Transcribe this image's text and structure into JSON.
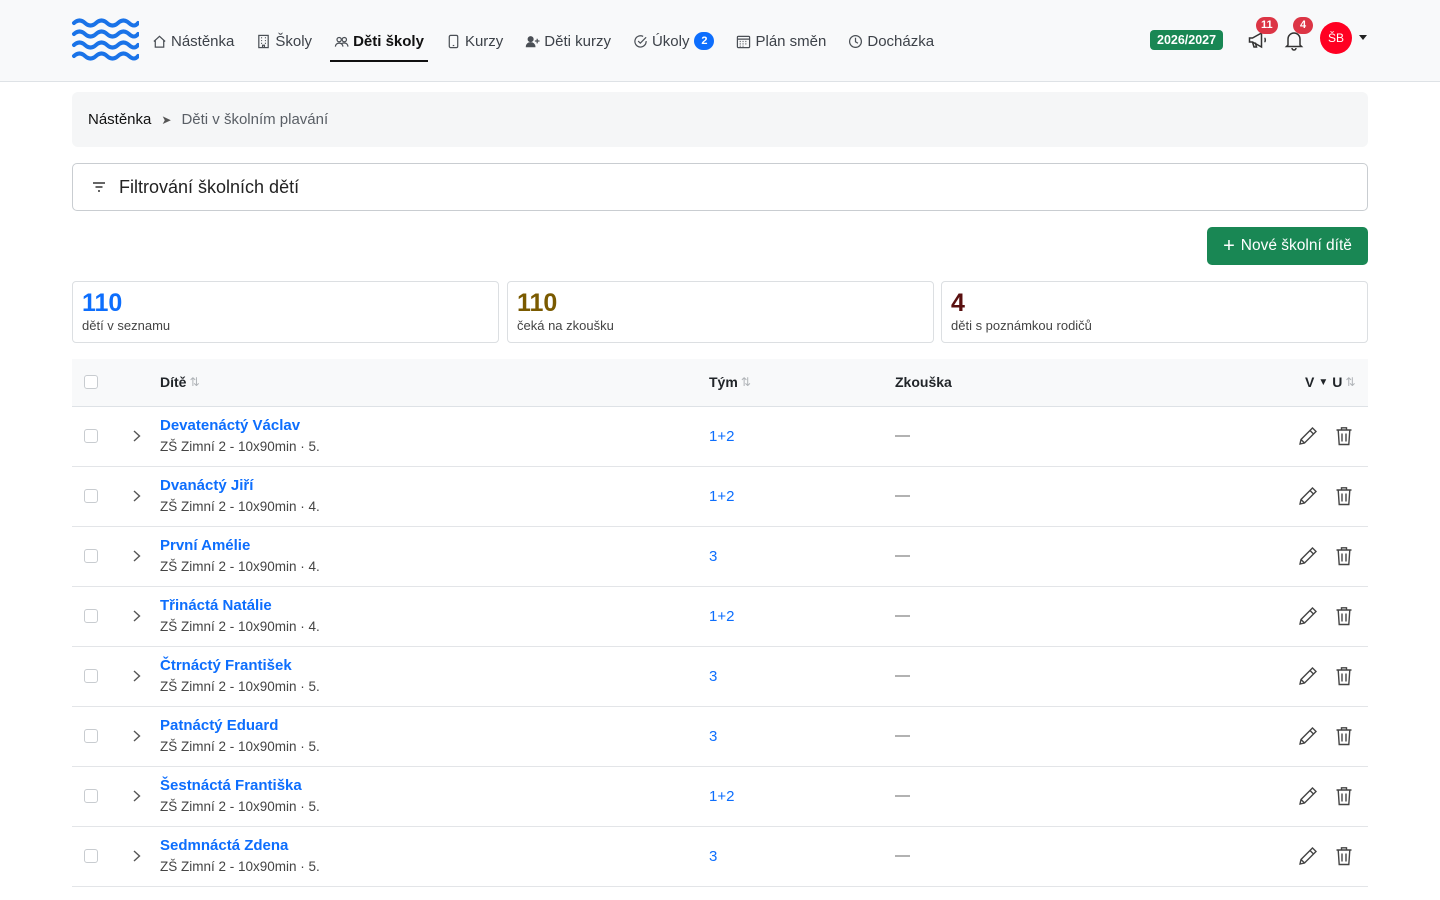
{
  "nav": {
    "items": [
      {
        "label": "Nástěnka",
        "icon": "house-icon"
      },
      {
        "label": "Školy",
        "icon": "building-icon"
      },
      {
        "label": "Děti školy",
        "icon": "people-icon",
        "active": true
      },
      {
        "label": "Kurzy",
        "icon": "tablet-icon"
      },
      {
        "label": "Děti kurzy",
        "icon": "person-plus-icon"
      },
      {
        "label": "Úkoly",
        "icon": "check-circle-icon",
        "badge": "2"
      },
      {
        "label": "Plán směn",
        "icon": "calendar-icon"
      },
      {
        "label": "Docházka",
        "icon": "clock-icon"
      }
    ],
    "year": "2026/2027",
    "announcements_count": "11",
    "notifications_count": "4",
    "avatar_initials": "ŠB"
  },
  "breadcrumb": {
    "home": "Nástěnka",
    "separator": "➤",
    "current": "Děti v školním plavání"
  },
  "filter": {
    "label": "Filtrování školních dětí"
  },
  "new_button": {
    "label": "Nové školní dítě"
  },
  "stats": [
    {
      "value": "110",
      "label": "dětí v seznamu",
      "color": "#0d6efd"
    },
    {
      "value": "110",
      "label": "čeká na zkoušku",
      "color": "#7a5a00"
    },
    {
      "value": "4",
      "label": "děti s poznámkou rodičů",
      "color": "#5a1010"
    }
  ],
  "table": {
    "headers": {
      "child": "Dítě",
      "team": "Tým",
      "exam": "Zkouška",
      "vu_left": "V",
      "vu_right": "U"
    },
    "rows": [
      {
        "name": "Devatenáctý Václav",
        "sub": "ZŠ Zimní 2 - 10x90min · 5.",
        "team": "1+2",
        "exam": "—"
      },
      {
        "name": "Dvanáctý Jiří",
        "sub": "ZŠ Zimní 2 - 10x90min · 4.",
        "team": "1+2",
        "exam": "—"
      },
      {
        "name": "První Amélie",
        "sub": "ZŠ Zimní 2 - 10x90min · 4.",
        "team": "3",
        "exam": "—"
      },
      {
        "name": "Třináctá Natálie",
        "sub": "ZŠ Zimní 2 - 10x90min · 4.",
        "team": "1+2",
        "exam": "—"
      },
      {
        "name": "Čtrnáctý František",
        "sub": "ZŠ Zimní 2 - 10x90min · 5.",
        "team": "3",
        "exam": "—"
      },
      {
        "name": "Patnáctý Eduard",
        "sub": "ZŠ Zimní 2 - 10x90min · 5.",
        "team": "3",
        "exam": "—"
      },
      {
        "name": "Šestnáctá Františka",
        "sub": "ZŠ Zimní 2 - 10x90min · 5.",
        "team": "1+2",
        "exam": "—"
      },
      {
        "name": "Sedmnáctá Zdena",
        "sub": "ZŠ Zimní 2 - 10x90min · 5.",
        "team": "3",
        "exam": "—"
      }
    ]
  },
  "colors": {
    "accent": "#0d6efd",
    "success": "#198754",
    "danger": "#dc3545"
  }
}
